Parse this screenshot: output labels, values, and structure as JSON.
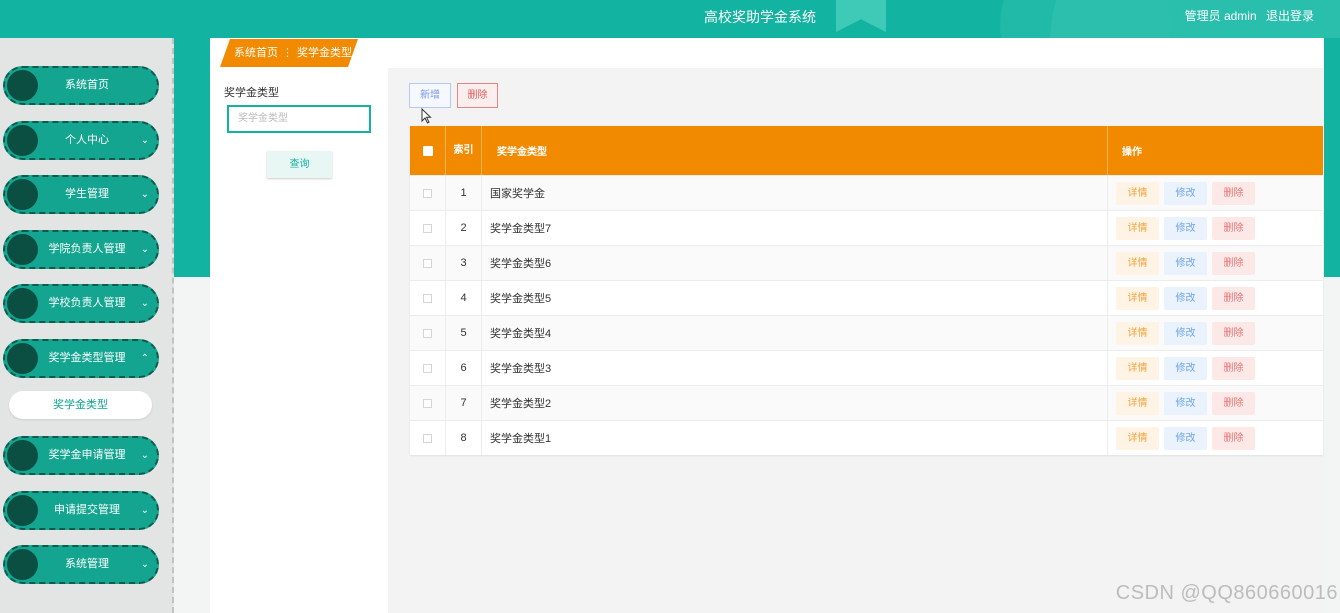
{
  "header": {
    "title": "高校奖助学金系统",
    "user_label": "管理员 admin",
    "logout_label": "退出登录"
  },
  "sidebar": {
    "items": [
      {
        "label": "系统首页",
        "chevron": ""
      },
      {
        "label": "个人中心",
        "chevron": "⌄"
      },
      {
        "label": "学生管理",
        "chevron": "⌄"
      },
      {
        "label": "学院负责人管理",
        "chevron": "⌄"
      },
      {
        "label": "学校负责人管理",
        "chevron": "⌄"
      },
      {
        "label": "奖学金类型管理",
        "chevron": "⌃"
      },
      {
        "label": "奖学金申请管理",
        "chevron": "⌄"
      },
      {
        "label": "申请提交管理",
        "chevron": "⌄"
      },
      {
        "label": "系统管理",
        "chevron": "⌄"
      }
    ],
    "sub_item": "奖学金类型"
  },
  "breadcrumb": {
    "home": "系统首页",
    "separator": "⋮",
    "current": "奖学金类型"
  },
  "search": {
    "label": "奖学金类型",
    "placeholder": "奖学金类型",
    "button": "查询"
  },
  "toolbar": {
    "add_label": "新增",
    "delete_label": "删除"
  },
  "table": {
    "headers": {
      "index": "索引",
      "name": "奖学金类型",
      "ops": "操作"
    },
    "ops": {
      "detail": "详情",
      "edit": "修改",
      "delete": "删除"
    },
    "rows": [
      {
        "index": "1",
        "name": "国家奖学金"
      },
      {
        "index": "2",
        "name": "奖学金类型7"
      },
      {
        "index": "3",
        "name": "奖学金类型6"
      },
      {
        "index": "4",
        "name": "奖学金类型5"
      },
      {
        "index": "5",
        "name": "奖学金类型4"
      },
      {
        "index": "6",
        "name": "奖学金类型3"
      },
      {
        "index": "7",
        "name": "奖学金类型2"
      },
      {
        "index": "8",
        "name": "奖学金类型1"
      }
    ]
  },
  "watermark": "CSDN @QQ860660016",
  "colors": {
    "primary": "#12b3a0",
    "accent": "#f28a00",
    "nav_dark": "#0a4f41"
  }
}
